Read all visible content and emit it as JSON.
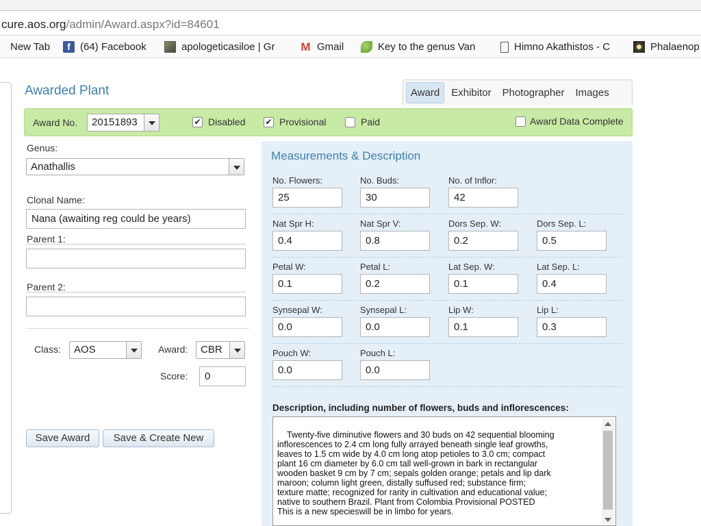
{
  "browser": {
    "url_host": "cure.aos.org",
    "url_path": "/admin/Award.aspx?id=84601",
    "bookmarks": [
      {
        "label": "New Tab",
        "icon": "none"
      },
      {
        "label": "(64) Facebook",
        "icon": "facebook-icon"
      },
      {
        "label": "apologeticasiloe | Gr",
        "icon": "photo-icon"
      },
      {
        "label": "Gmail",
        "icon": "gmail-icon"
      },
      {
        "label": "Key to the genus Van",
        "icon": "leaf-icon"
      },
      {
        "label": "Himno Akathistos - C",
        "icon": "document-icon"
      },
      {
        "label": "Phalaenop",
        "icon": "flower-icon"
      }
    ]
  },
  "header": {
    "title": "Awarded Plant",
    "tabs": [
      "Award",
      "Exhibitor",
      "Photographer",
      "Images"
    ],
    "active_tab": "Award"
  },
  "award_bar": {
    "award_no_label": "Award No.",
    "award_no": "20151893",
    "disabled_label": "Disabled",
    "disabled_checked": true,
    "provisional_label": "Provisional",
    "provisional_checked": true,
    "paid_label": "Paid",
    "paid_checked": false,
    "complete_label": "Award Data Complete",
    "complete_checked": false,
    "check_glyph": "✔"
  },
  "form": {
    "genus_label": "Genus:",
    "genus": "Anathallis",
    "clonal_label": "Clonal Name:",
    "clonal": "Nana (awaiting reg could be years)",
    "parent1_label": "Parent 1:",
    "parent1": "",
    "parent2_label": "Parent 2:",
    "parent2": "",
    "class_label": "Class:",
    "class": "AOS",
    "award_label": "Award:",
    "award": "CBR",
    "score_label": "Score:",
    "score": "0",
    "save_label": "Save Award",
    "save_new_label": "Save & Create New"
  },
  "measurements": {
    "title": "Measurements & Description",
    "rows": [
      [
        {
          "label": "No. Flowers:",
          "value": "25"
        },
        {
          "label": "No. Buds:",
          "value": "30"
        },
        {
          "label": "No. of Inflor:",
          "value": "42"
        }
      ],
      [
        {
          "label": "Nat Spr H:",
          "value": "0.4"
        },
        {
          "label": "Nat Spr V:",
          "value": "0.8"
        },
        {
          "label": "Dors Sep. W:",
          "value": "0.2"
        },
        {
          "label": "Dors Sep. L:",
          "value": "0.5"
        }
      ],
      [
        {
          "label": "Petal W:",
          "value": "0.1"
        },
        {
          "label": "Petal L:",
          "value": "0.2"
        },
        {
          "label": "Lat Sep. W:",
          "value": "0.1"
        },
        {
          "label": "Lat Sep. L:",
          "value": "0.4"
        }
      ],
      [
        {
          "label": "Synsepal W:",
          "value": "0.0"
        },
        {
          "label": "Synsepal L:",
          "value": "0.0"
        },
        {
          "label": "Lip W:",
          "value": "0.1"
        },
        {
          "label": "Lip L:",
          "value": "0.3"
        }
      ],
      [
        {
          "label": "Pouch W:",
          "value": "0.0"
        },
        {
          "label": "Pouch L:",
          "value": "0.0"
        }
      ]
    ],
    "description_label": "Description, including number of flowers, buds and inflorescences:",
    "description": "Twenty-five diminutive flowers and 30 buds on 42 sequential blooming\ninflorescences to 2.4 cm long fully arrayed beneath single leaf growths,\nleaves to 1.5 cm wide by 4.0 cm long atop petioles to 3.0 cm; compact\nplant 16 cm diameter by 6.0 cm tall well-grown in bark in rectangular\nwooden basket 9 cm by 7 cm; sepals golden orange; petals and lip dark\nmaroon; column light green, distally suffused red; substance firm;\ntexture matte; recognized for rarity in cultivation and educational value;\nnative to southern Brazil. Plant from Colombia Provisional POSTED\nThis is a new specieswill be in limbo for years."
  }
}
